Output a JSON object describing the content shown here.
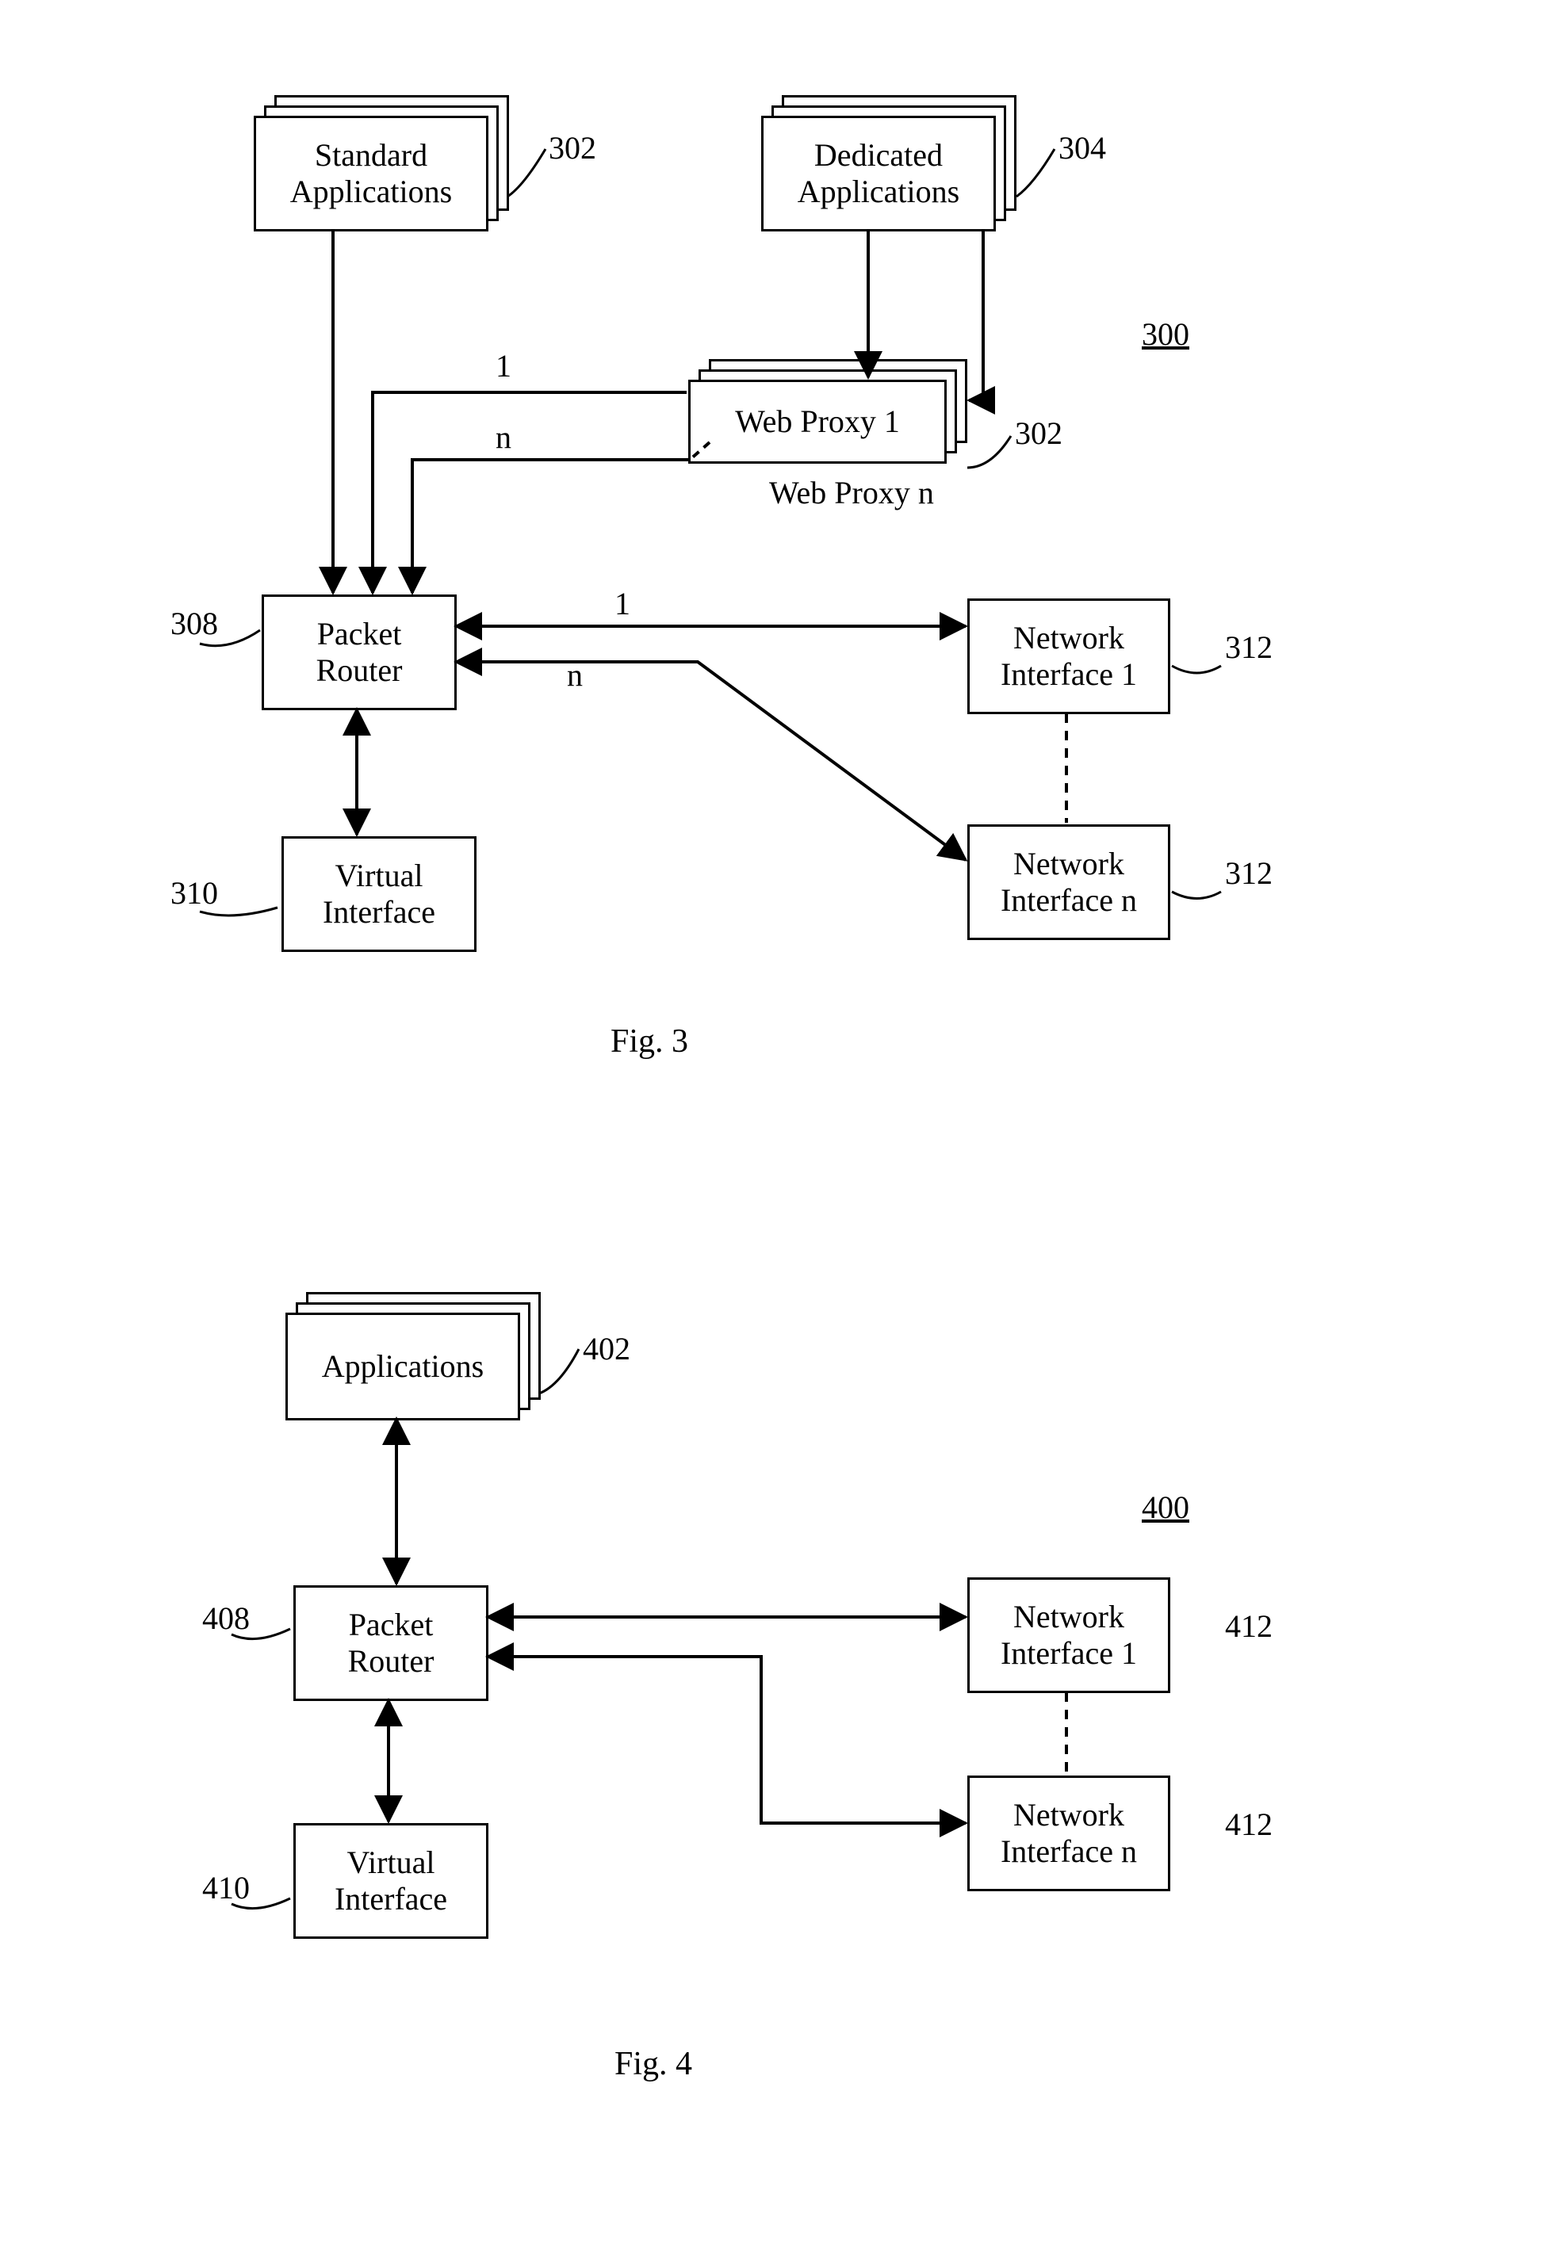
{
  "fig3": {
    "id": "300",
    "caption": "Fig. 3",
    "std_apps": {
      "text": "Standard\nApplications",
      "ref": "302"
    },
    "ded_apps": {
      "text": "Dedicated\nApplications",
      "ref": "304"
    },
    "web_proxy_1": {
      "text": "Web Proxy 1"
    },
    "web_proxy_n": {
      "text": "Web Proxy n",
      "ref": "302"
    },
    "edge_labels": {
      "wp1_to_pr": "1",
      "wpn_to_pr": "n",
      "pr_to_ni1": "1",
      "pr_to_nin": "n"
    },
    "packet_router": {
      "text": "Packet\nRouter",
      "ref": "308"
    },
    "virtual_if": {
      "text": "Virtual\nInterface",
      "ref": "310"
    },
    "net_if_1": {
      "text": "Network\nInterface 1",
      "ref": "312"
    },
    "net_if_n": {
      "text": "Network\nInterface n",
      "ref": "312"
    }
  },
  "fig4": {
    "id": "400",
    "caption": "Fig. 4",
    "apps": {
      "text": "Applications",
      "ref": "402"
    },
    "packet_router": {
      "text": "Packet\nRouter",
      "ref": "408"
    },
    "virtual_if": {
      "text": "Virtual\nInterface",
      "ref": "410"
    },
    "net_if_1": {
      "text": "Network\nInterface 1",
      "ref": "412"
    },
    "net_if_n": {
      "text": "Network\nInterface n",
      "ref": "412"
    }
  }
}
